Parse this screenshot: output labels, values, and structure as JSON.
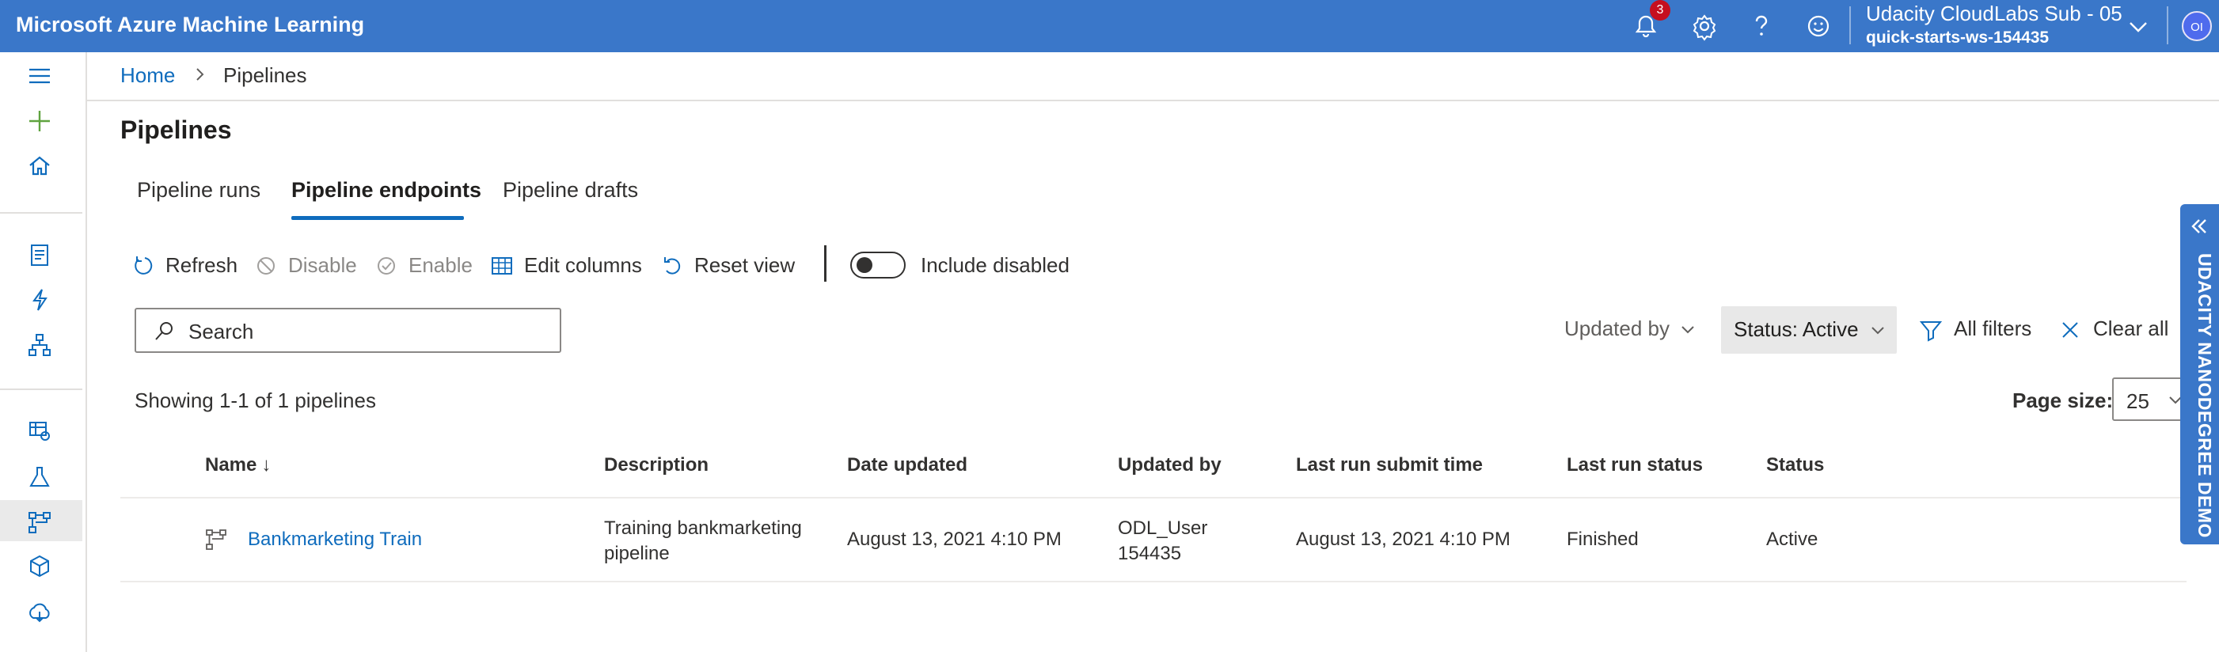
{
  "app": {
    "title": "Microsoft Azure Machine Learning"
  },
  "topbar": {
    "notification_count": "3",
    "account_name": "Udacity CloudLabs Sub - 05",
    "workspace": "quick-starts-ws-154435",
    "avatar_initials": "OI",
    "icons": [
      "bell-icon",
      "gear-icon",
      "help-icon",
      "smiley-icon",
      "chevron-down-icon"
    ]
  },
  "sidebar": {
    "items": [
      "hamburger-icon",
      "plus-icon",
      "home-icon",
      "notebook-icon",
      "automl-icon",
      "designer-icon",
      "datasets-icon",
      "experiments-icon",
      "pipelines-icon",
      "models-icon",
      "endpoints-icon"
    ],
    "active": "pipelines-icon"
  },
  "breadcrumb": {
    "home": "Home",
    "current": "Pipelines"
  },
  "page": {
    "title": "Pipelines"
  },
  "tabs": [
    {
      "label": "Pipeline runs"
    },
    {
      "label": "Pipeline endpoints",
      "active": true
    },
    {
      "label": "Pipeline drafts"
    }
  ],
  "toolbar": {
    "refresh": "Refresh",
    "disable": "Disable",
    "enable": "Enable",
    "edit_columns": "Edit columns",
    "reset_view": "Reset view",
    "include_disabled": "Include disabled"
  },
  "search": {
    "placeholder": "Search"
  },
  "filters": {
    "updated_by": "Updated by",
    "status": "Status: Active",
    "all_filters": "All filters",
    "clear_all": "Clear all"
  },
  "summary": {
    "showing": "Showing 1-1 of 1 pipelines"
  },
  "paging": {
    "label": "Page size:",
    "value": "25"
  },
  "table": {
    "columns": {
      "name": "Name",
      "sort_indicator": "↓",
      "description": "Description",
      "date_updated": "Date updated",
      "updated_by": "Updated by",
      "last_run_submit_time": "Last run submit time",
      "last_run_status": "Last run status",
      "status": "Status"
    },
    "rows": [
      {
        "name": "Bankmarketing Train",
        "description_line1": "Training bankmarketing",
        "description_line2": "pipeline",
        "date_updated": "August 13, 2021 4:10 PM",
        "updated_by_line1": "ODL_User",
        "updated_by_line2": "154435",
        "last_run_submit_time": "August 13, 2021 4:10 PM",
        "last_run_status": "Finished",
        "status": "Active"
      }
    ]
  },
  "banner": {
    "text": "UDACITY NANODEGREE DEMO"
  },
  "colors": {
    "brand_blue": "#3a77c9",
    "link_blue": "#0f6cbd",
    "banner_blue": "#3a77c9"
  }
}
